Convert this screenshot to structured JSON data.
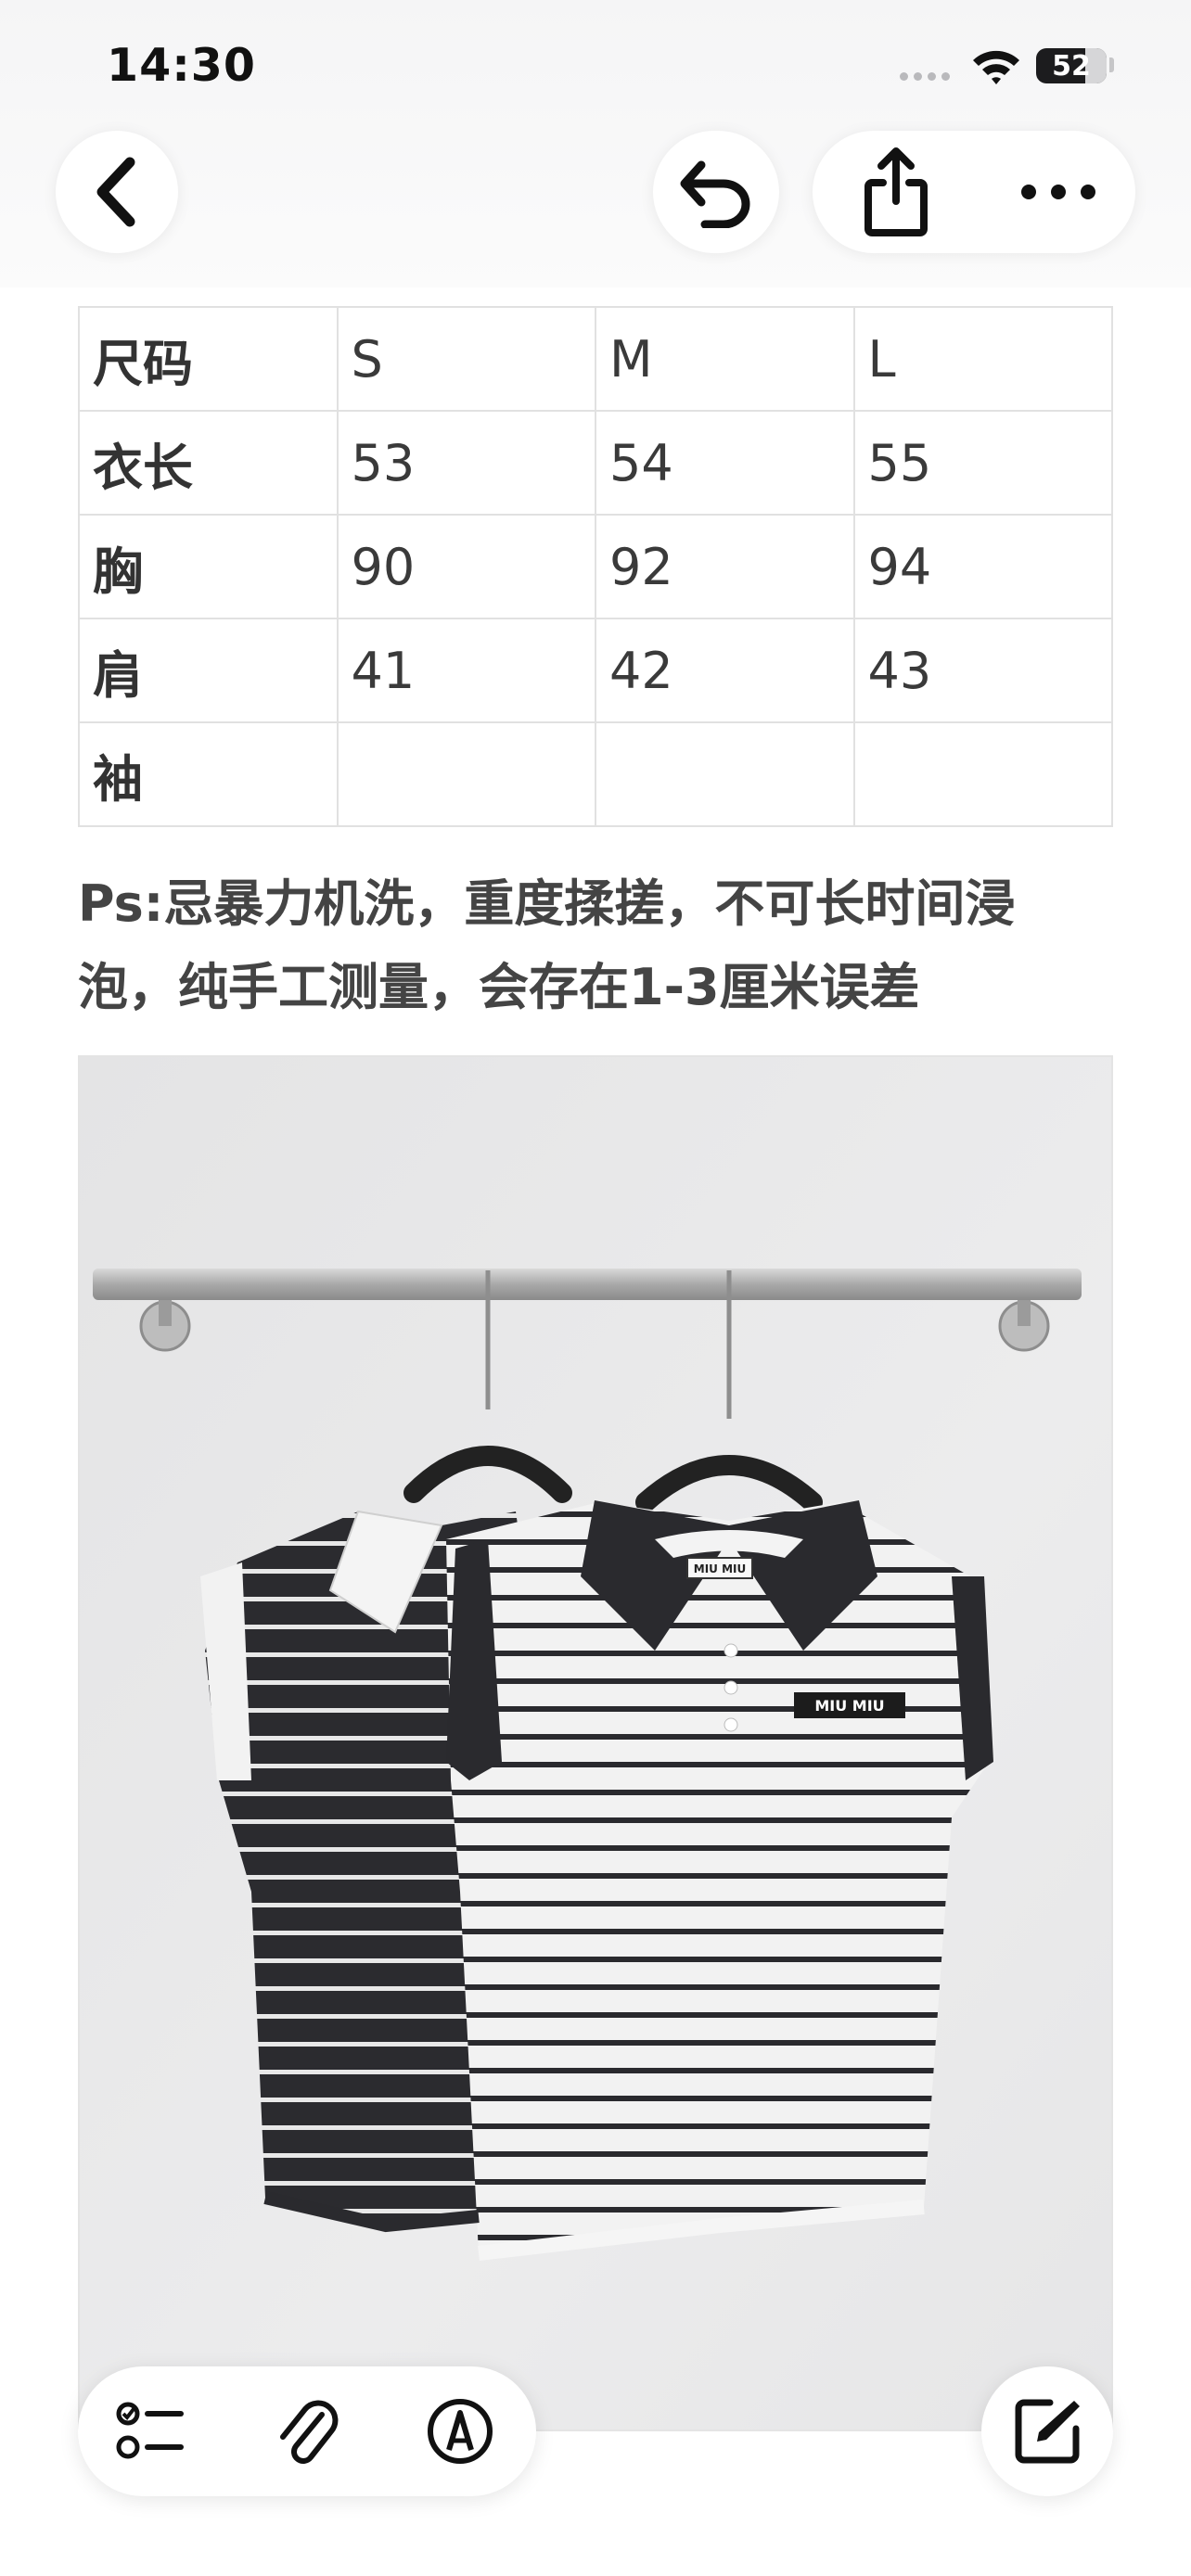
{
  "status_bar": {
    "time": "14:30",
    "battery": "52"
  },
  "nav": {
    "back_icon": "chevron-left-icon",
    "undo_icon": "undo-icon",
    "share_icon": "share-icon",
    "more_icon": "more-icon"
  },
  "size_table": {
    "rows": [
      [
        "尺码",
        "S",
        "M",
        "L"
      ],
      [
        "衣长",
        "53",
        "54",
        "55"
      ],
      [
        "胸",
        "90",
        "92",
        "94"
      ],
      [
        "肩",
        "41",
        "42",
        "43"
      ],
      [
        "袖",
        "",
        "",
        ""
      ]
    ]
  },
  "note": {
    "line1": "Ps:忌暴力机洗，重度揉搓，不可长时间浸",
    "line2": "泡，纯手工测量，会存在1-3厘米误差"
  },
  "photo": {
    "label_collar": "MIU MIU",
    "label_chest": "MIU MIU"
  },
  "toolbar": {
    "checklist_icon": "checklist-icon",
    "attachment_icon": "paperclip-icon",
    "markup_icon": "pen-markup-icon",
    "compose_icon": "compose-icon"
  }
}
